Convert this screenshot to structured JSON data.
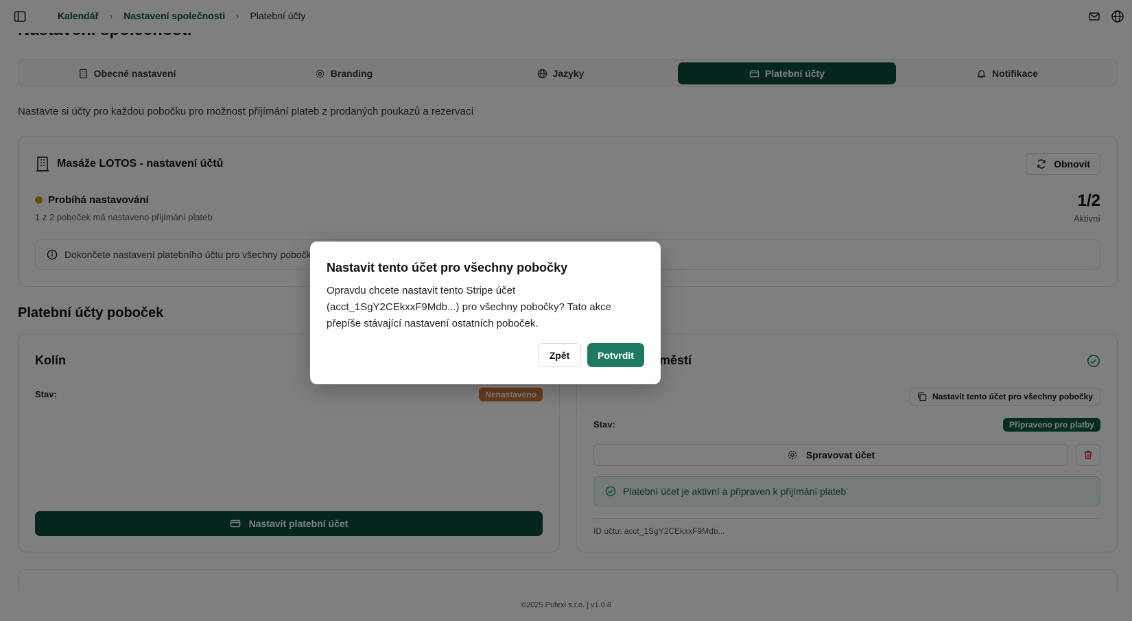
{
  "breadcrumb": {
    "items": [
      "Kalendář",
      "Nastavení společnosti"
    ],
    "current": "Platební účty"
  },
  "page": {
    "title": "Nastavení společnosti",
    "intro": "Nastavte si účty pro každou pobočku pro možnost příjímání plateb z prodaných poukazů a rezervací"
  },
  "tabs": [
    {
      "label": "Obecné nastavení",
      "icon": "building-icon"
    },
    {
      "label": "Branding",
      "icon": "gear-icon"
    },
    {
      "label": "Jazyky",
      "icon": "globe-icon"
    },
    {
      "label": "Platební účty",
      "icon": "credit-card-icon",
      "active": true
    },
    {
      "label": "Notifikace",
      "icon": "bell-icon"
    }
  ],
  "company": {
    "title": "Masáže LOTOS - nastavení účtů",
    "refresh_label": "Obnovit",
    "status": "Probíhá nastavování",
    "status_sub": "1 z 2 poboček má nastaveno přijímání plateb",
    "counter": "1/2",
    "counter_label": "Aktivní",
    "info": "Dokončete nastavení platebního účtu pro všechny pobočky"
  },
  "branches": {
    "section_title": "Platební účty poboček",
    "first": {
      "title": "Kolín",
      "state_label": "Stav:",
      "badge": "Nenastaveno",
      "setup_button": "Nastavit platební účet"
    },
    "second": {
      "title_visible": "áměstí",
      "copy_button": "Nastavit tento účet pro všechny pobočky",
      "state_label": "Stav:",
      "badge": "Připraveno pro platby",
      "manage_button": "Spravovat účet",
      "success": "Platební účet je aktivní a připraven k přijímání plateb",
      "account_id": "ID účtu: acct_1SgY2CEkxxF9Mdb..."
    }
  },
  "footer": "©2025 Pufexi s.r.o.  |  v1.0.8",
  "dialog": {
    "title": "Nastavit tento účet pro všechny pobočky",
    "body": "Opravdu chcete nastavit tento Stripe účet (acct_1SgY2CEkxxF9Mdb...) pro všechny pobočky? Tato akce přepíše stávající nastavení ostatních poboček.",
    "back": "Zpět",
    "confirm": "Potvrdit"
  },
  "colors": {
    "brand": "#0b4d3c",
    "warning_badge": "#d2763a",
    "success_badge": "#0e5a47",
    "status_dot": "#c99a0a"
  }
}
